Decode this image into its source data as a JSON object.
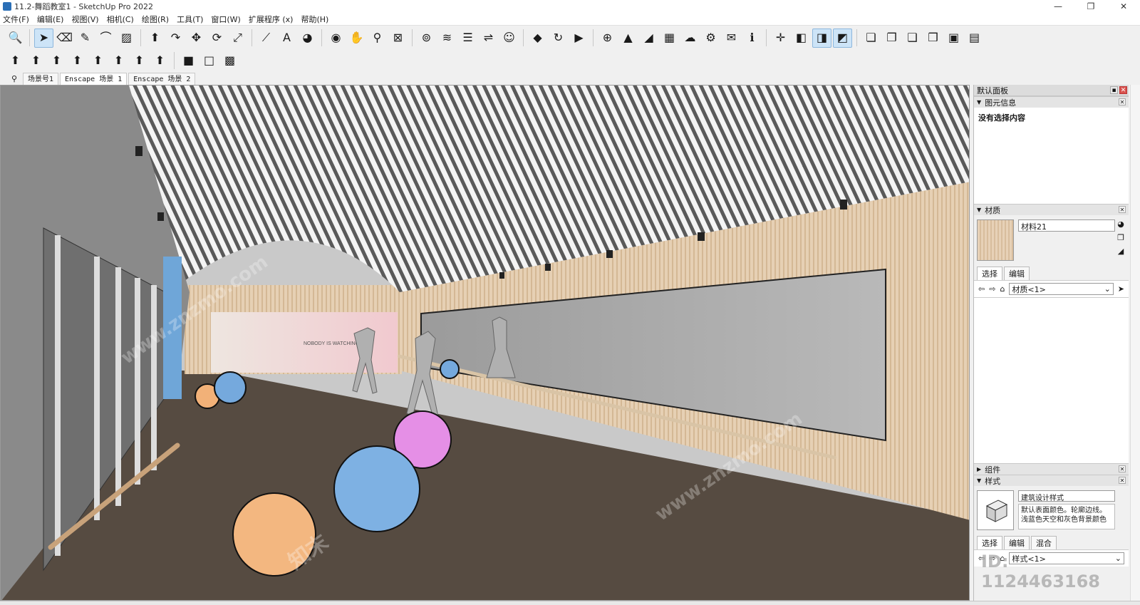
{
  "window": {
    "title": "11.2-舞蹈教室1 - SketchUp Pro 2022",
    "controls": [
      "—",
      "❐",
      "✕"
    ]
  },
  "menu": [
    "文件(F)",
    "编辑(E)",
    "视图(V)",
    "相机(C)",
    "绘图(R)",
    "工具(T)",
    "窗口(W)",
    "扩展程序 (x)",
    "帮助(H)"
  ],
  "toolbar_row1": [
    {
      "name": "zoom-extents-icon",
      "glyph": "🔍"
    },
    {
      "name": "select-icon",
      "glyph": "➤",
      "selected": true
    },
    {
      "name": "eraser-icon",
      "glyph": "⌫"
    },
    {
      "name": "pencil-icon",
      "glyph": "✎"
    },
    {
      "name": "arc-icon",
      "glyph": "⌒"
    },
    {
      "name": "shape-icon",
      "glyph": "▨"
    },
    {
      "name": "push-pull-icon",
      "glyph": "⬆"
    },
    {
      "name": "follow-me-icon",
      "glyph": "↷"
    },
    {
      "name": "move-icon",
      "glyph": "✥"
    },
    {
      "name": "rotate-icon",
      "glyph": "⟳"
    },
    {
      "name": "scale-icon",
      "glyph": "⤢"
    },
    {
      "name": "tape-measure-icon",
      "glyph": "⟋"
    },
    {
      "name": "text-icon",
      "glyph": "A"
    },
    {
      "name": "paint-bucket-icon",
      "glyph": "◕"
    },
    {
      "name": "orbit-icon",
      "glyph": "◉"
    },
    {
      "name": "pan-icon",
      "glyph": "✋"
    },
    {
      "name": "zoom-icon",
      "glyph": "⚲"
    },
    {
      "name": "zoom-window-icon",
      "glyph": "⊠"
    },
    {
      "name": "warehouse-icon",
      "glyph": "⊚"
    },
    {
      "name": "extension-icon",
      "glyph": "≋"
    },
    {
      "name": "layers-icon",
      "glyph": "☰"
    },
    {
      "name": "sync-icon",
      "glyph": "⇌"
    },
    {
      "name": "profile-icon",
      "glyph": "☺"
    },
    {
      "name": "enscape-start-icon",
      "glyph": "◆"
    },
    {
      "name": "enscape-sync-icon",
      "glyph": "↻"
    },
    {
      "name": "enscape-video-icon",
      "glyph": "▶"
    },
    {
      "name": "add-icon",
      "glyph": "⊕"
    },
    {
      "name": "tree-icon",
      "glyph": "▲"
    },
    {
      "name": "asset-icon",
      "glyph": "◢"
    },
    {
      "name": "texture-icon",
      "glyph": "▦"
    },
    {
      "name": "upload-icon",
      "glyph": "☁"
    },
    {
      "name": "settings-icon",
      "glyph": "⚙"
    },
    {
      "name": "mail-icon",
      "glyph": "✉"
    },
    {
      "name": "info-icon",
      "glyph": "ℹ"
    },
    {
      "name": "axes-icon",
      "glyph": "✛"
    },
    {
      "name": "view-iso-icon",
      "glyph": "◧"
    },
    {
      "name": "view-top-icon",
      "glyph": "◨",
      "selected": true
    },
    {
      "name": "view-front-icon",
      "glyph": "◩",
      "selected": true
    },
    {
      "name": "component-a-icon",
      "glyph": "❏"
    },
    {
      "name": "component-b-icon",
      "glyph": "❐"
    },
    {
      "name": "component-c-icon",
      "glyph": "❑"
    },
    {
      "name": "component-d-icon",
      "glyph": "❒"
    },
    {
      "name": "component-e-icon",
      "glyph": "▣"
    },
    {
      "name": "component-f-icon",
      "glyph": "▤"
    }
  ],
  "toolbar_row2": [
    {
      "name": "push-red-icon",
      "glyph": "⬆"
    },
    {
      "name": "push-blue-icon",
      "glyph": "⬆"
    },
    {
      "name": "push-multi-a-icon",
      "glyph": "⬆"
    },
    {
      "name": "push-multi-b-icon",
      "glyph": "⬆"
    },
    {
      "name": "push-multi-c-icon",
      "glyph": "⬆"
    },
    {
      "name": "push-multi-d-icon",
      "glyph": "⬆"
    },
    {
      "name": "push-multi-e-icon",
      "glyph": "⬆"
    },
    {
      "name": "push-multi-f-icon",
      "glyph": "⬆"
    },
    {
      "name": "cube-yellow-icon",
      "glyph": "■"
    },
    {
      "name": "cube-white-icon",
      "glyph": "□"
    },
    {
      "name": "cube-green-icon",
      "glyph": "▩"
    }
  ],
  "scene_tabs": [
    "场景号1",
    "Enscape 场景 1",
    "Enscape 场景 2"
  ],
  "scene": {
    "poster_text": "NOBODY IS WATCHING"
  },
  "tray": {
    "title": "默认面板",
    "entity_info": {
      "header": "图元信息",
      "empty": "没有选择内容"
    },
    "materials": {
      "header": "材质",
      "name": "材料21",
      "tabs": [
        "选择",
        "编辑"
      ],
      "collection": "材质<1>"
    },
    "components": {
      "header": "组件"
    },
    "styles": {
      "header": "样式",
      "name": "建筑设计样式",
      "desc": "默认表面颜色。轮廓边线。浅蓝色天空和灰色背景颜色",
      "tabs": [
        "选择",
        "编辑",
        "混合"
      ],
      "collection": "样式<1>"
    }
  },
  "watermark": {
    "brand": "知末",
    "site": "www.znzmo.com",
    "id": "ID: 1124463168"
  }
}
